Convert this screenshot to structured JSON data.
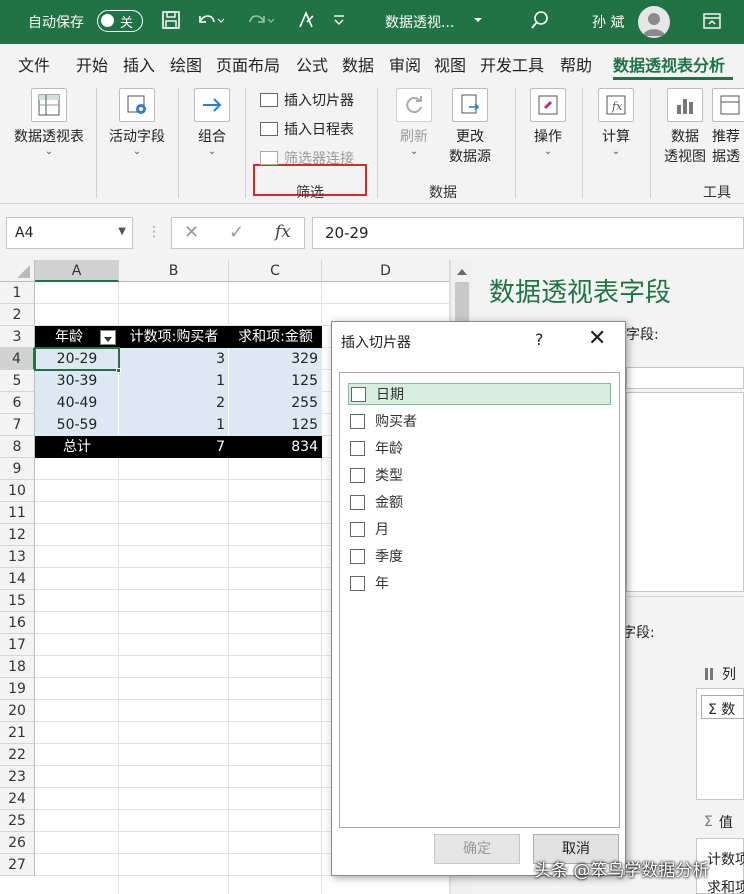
{
  "titlebar": {
    "autosave_label": "自动保存",
    "autosave_state": "关",
    "doc_title": "数据透视...",
    "user_name": "孙 斌"
  },
  "tabs": [
    "文件",
    "开始",
    "插入",
    "绘图",
    "页面布局",
    "公式",
    "数据",
    "审阅",
    "视图",
    "开发工具",
    "帮助",
    "数据透视表分析"
  ],
  "ribbon": {
    "pivot_table": "数据透视表",
    "active_field": "活动字段",
    "group": "组合",
    "insert_slicer": "插入切片器",
    "insert_timeline": "插入日程表",
    "filter_connections": "筛选器连接",
    "filter_group": "筛选",
    "refresh": "刷新",
    "change_source_line1": "更改",
    "change_source_line2": "数据源",
    "data_group": "数据",
    "actions": "操作",
    "calculations": "计算",
    "pivot_chart_line1": "数据",
    "pivot_chart_line2": "透视图",
    "recommended_line1": "推荐",
    "recommended_line2": "据透",
    "tools_group": "工具"
  },
  "formula_bar": {
    "name_box": "A4",
    "fx": "fx",
    "value": "20-29"
  },
  "sheet": {
    "columns": [
      "A",
      "B",
      "C",
      "D"
    ],
    "rows": [
      "1",
      "2",
      "3",
      "4",
      "5",
      "6",
      "7",
      "8",
      "9",
      "10",
      "11",
      "12",
      "13",
      "14",
      "15",
      "16",
      "17",
      "18",
      "19",
      "20",
      "21",
      "22",
      "23",
      "24",
      "25",
      "26",
      "27"
    ],
    "headers": [
      "年龄",
      "计数项:购买者",
      "求和项:金额"
    ],
    "data": [
      [
        "20-29",
        "3",
        "329"
      ],
      [
        "30-39",
        "1",
        "125"
      ],
      [
        "40-49",
        "2",
        "255"
      ],
      [
        "50-59",
        "1",
        "125"
      ]
    ],
    "total": [
      "总计",
      "7",
      "834"
    ]
  },
  "pane": {
    "title": "数据透视表字段",
    "choose_fields_suffix": "字段:",
    "drag_fields_suffix": "字段:",
    "columns_label": "列",
    "values_label": "值",
    "columns_item": "数",
    "values_item_1": "计数项",
    "values_item_2": "求和项"
  },
  "dialog": {
    "title": "插入切片器",
    "help": "?",
    "fields": [
      "日期",
      "购买者",
      "年龄",
      "类型",
      "金额",
      "月",
      "季度",
      "年"
    ],
    "ok": "确定",
    "cancel": "取消"
  },
  "watermark": "头条 @笨鸟学数据分析"
}
